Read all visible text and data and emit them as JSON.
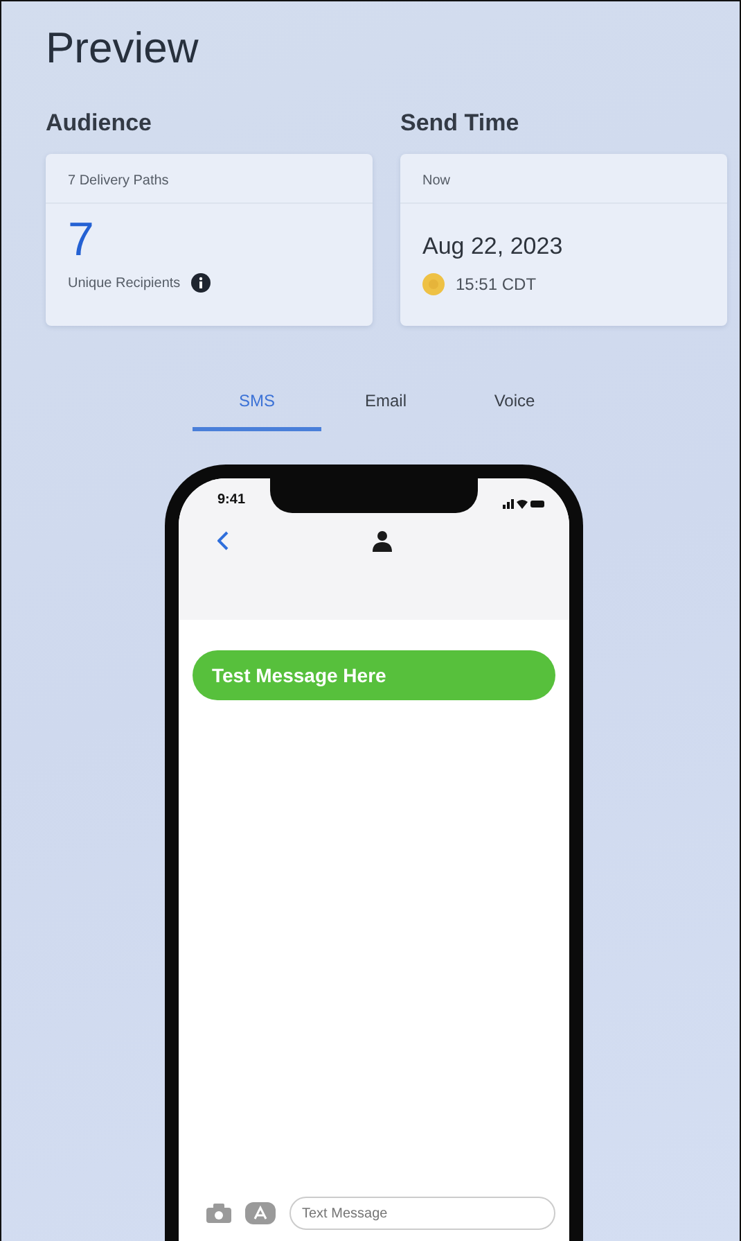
{
  "title": "Preview",
  "audience": {
    "heading": "Audience",
    "paths": "7 Delivery Paths",
    "count": "7",
    "caption": "Unique Recipients"
  },
  "send_time": {
    "heading": "Send Time",
    "label": "Now",
    "date": "Aug 22, 2023",
    "time": "15:51 CDT"
  },
  "tabs": [
    {
      "label": "SMS",
      "selected": true
    },
    {
      "label": "Email",
      "selected": false
    },
    {
      "label": "Voice",
      "selected": false
    }
  ],
  "phone": {
    "clock": "9:41",
    "messages": [
      {
        "text": "Test Message Here"
      }
    ],
    "compose": {
      "placeholder": "Text Message"
    }
  }
}
